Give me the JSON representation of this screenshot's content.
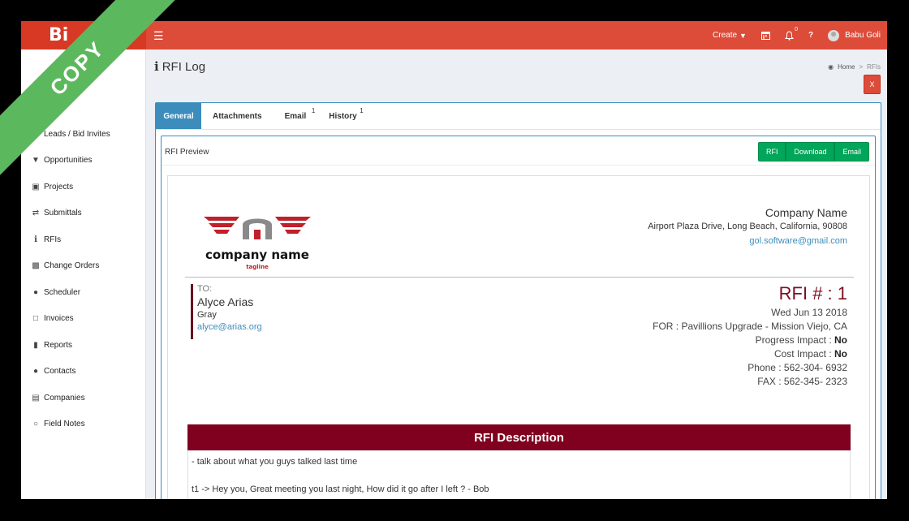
{
  "watermark": "COPY",
  "topbar": {
    "brand": "Bi",
    "create_label": "Create",
    "notification_count": "0",
    "help_label": "?",
    "user_name": "Babu Goli"
  },
  "sidebar": {
    "items": [
      {
        "label": "Leads / Bid Invites",
        "icon": "envelope-icon"
      },
      {
        "label": "Opportunities",
        "icon": "filter-icon"
      },
      {
        "label": "Projects",
        "icon": "briefcase-icon"
      },
      {
        "label": "Submittals",
        "icon": "exchange-icon"
      },
      {
        "label": "RFIs",
        "icon": "info-icon"
      },
      {
        "label": "Change Orders",
        "icon": "folder-icon"
      },
      {
        "label": "Scheduler",
        "icon": "users-icon"
      },
      {
        "label": "Invoices",
        "icon": "file-icon"
      },
      {
        "label": "Reports",
        "icon": "bar-chart-icon"
      },
      {
        "label": "Contacts",
        "icon": "user-icon"
      },
      {
        "label": "Companies",
        "icon": "institution-icon"
      },
      {
        "label": "Field Notes",
        "icon": "comment-icon"
      }
    ]
  },
  "page": {
    "title": "RFI Log",
    "breadcrumb_home": "Home",
    "breadcrumb_current": "RFIs",
    "close_label": "X"
  },
  "tabs": [
    {
      "label": "General",
      "count": ""
    },
    {
      "label": "Attachments",
      "count": ""
    },
    {
      "label": "Email",
      "count": "1"
    },
    {
      "label": "History",
      "count": "1"
    }
  ],
  "preview": {
    "title": "RFI Preview",
    "buttons": {
      "rfi": "RFI",
      "download": "Download",
      "email": "Email"
    }
  },
  "document": {
    "logo_text": "company name",
    "logo_tagline": "tagline",
    "company_name": "Company Name",
    "company_address": "Airport Plaza Drive, Long Beach, California, 90808",
    "company_email": "gol.software@gmail.com",
    "to_label": "TO:",
    "to_name": "Alyce Arias",
    "to_company": "Gray",
    "to_email": "alyce@arias.org",
    "rfi_number": "RFI # : 1",
    "date": "Wed Jun 13 2018",
    "for_line": "FOR : Pavillions Upgrade - Mission Viejo, CA",
    "progress_label": "Progress Impact : ",
    "progress_value": "No",
    "cost_label": "Cost Impact : ",
    "cost_value": "No",
    "phone": "Phone : 562-304- 6932",
    "fax": "FAX : 562-345- 2323",
    "description_title": "RFI Description",
    "description_lines": [
      "- talk about what you guys talked last time",
      "t1 -> Hey you, Great meeting you last night, How did it go after I left ? - Bob"
    ]
  },
  "colors": {
    "topbar": "#dd4b39",
    "primary": "#3c8dbc",
    "success": "#00a65a",
    "rfi_accent": "#800020",
    "ribbon": "#5cb85c"
  }
}
